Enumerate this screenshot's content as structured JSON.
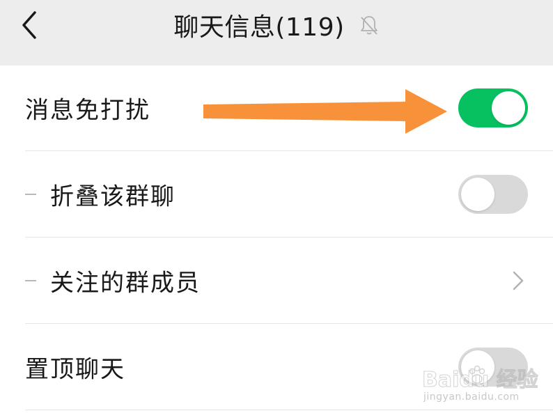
{
  "header": {
    "title": "聊天信息(119)",
    "back_icon": "chevron-left-icon",
    "mute_icon": "bell-off-icon"
  },
  "settings": [
    {
      "label": "消息免打扰",
      "control": "toggle",
      "state": "on"
    },
    {
      "label": "折叠该群聊",
      "control": "toggle",
      "state": "off"
    },
    {
      "label": "关注的群成员",
      "control": "chevron"
    },
    {
      "label": "置顶聊天",
      "control": "toggle",
      "state": "off"
    }
  ],
  "annotation": {
    "type": "arrow",
    "color": "#f7923a"
  },
  "watermark": {
    "brand": "Baidu 经验",
    "site": "jingyan.baidu.com"
  },
  "colors": {
    "toggle_on": "#07c160",
    "toggle_off": "#d9d9d9",
    "header_bg": "#ededed",
    "panel_bg": "#ffffff"
  }
}
